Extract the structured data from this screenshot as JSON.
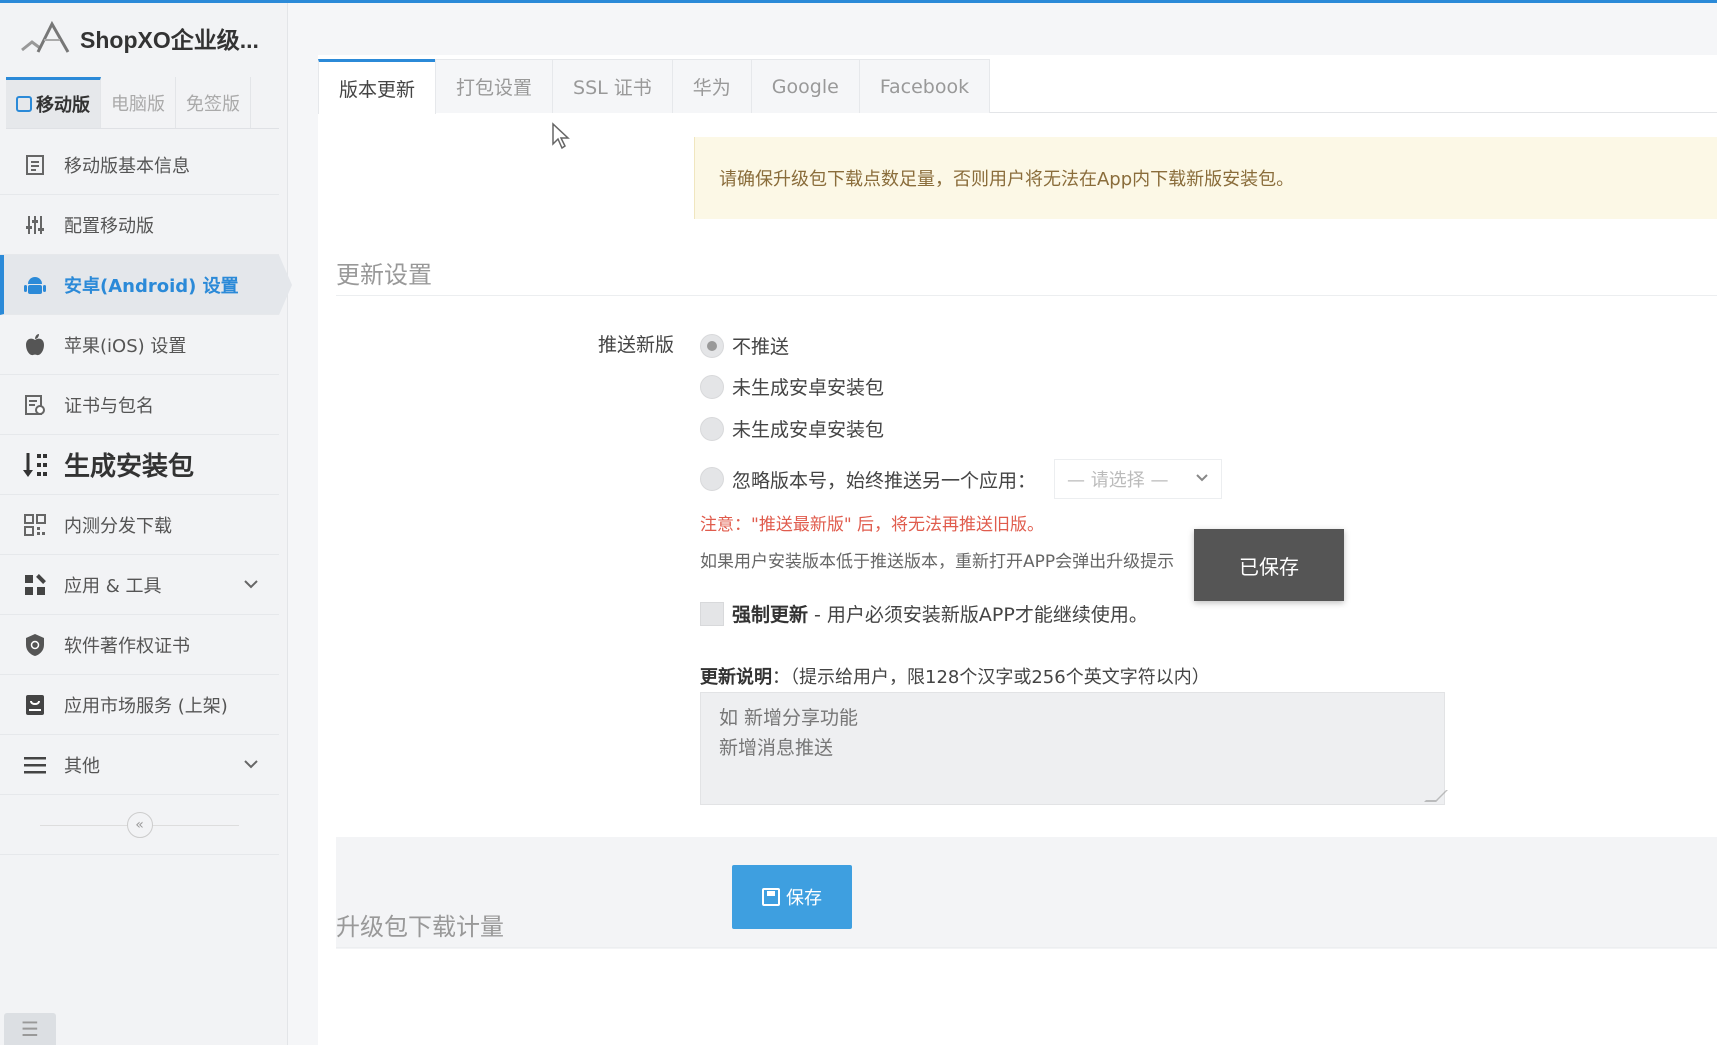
{
  "brand": {
    "title": "ShopXO企业级..."
  },
  "version_tabs": [
    {
      "label": "移动版",
      "active": true
    },
    {
      "label": "电脑版",
      "active": false
    },
    {
      "label": "免签版",
      "active": false
    }
  ],
  "nav": {
    "items": [
      {
        "label": "移动版基本信息",
        "icon": "document-icon"
      },
      {
        "label": "配置移动版",
        "icon": "sliders-icon"
      },
      {
        "label": "安卓(Android) 设置",
        "icon": "android-icon",
        "active": true
      },
      {
        "label": "苹果(iOS) 设置",
        "icon": "apple-icon"
      },
      {
        "label": "证书与包名",
        "icon": "certificate-icon"
      },
      {
        "label": "生成安装包",
        "icon": "sort-download-icon",
        "big": true
      },
      {
        "label": "内测分发下载",
        "icon": "qrcode-icon"
      },
      {
        "label": "应用 & 工具",
        "icon": "apps-icon",
        "expandable": true
      },
      {
        "label": "软件著作权证书",
        "icon": "shield-icon"
      },
      {
        "label": "应用市场服务 (上架)",
        "icon": "store-icon"
      },
      {
        "label": "其他",
        "icon": "menu-icon",
        "expandable": true
      }
    ],
    "collapse_glyph": "«",
    "toggle_glyph": "☰"
  },
  "tabs": [
    {
      "label": "版本更新",
      "active": true
    },
    {
      "label": "打包设置"
    },
    {
      "label": "SSL 证书"
    },
    {
      "label": "华为"
    },
    {
      "label": "Google"
    },
    {
      "label": "Facebook"
    }
  ],
  "notice": "请确保升级包下载点数足量，否则用户将无法在App内下载新版安装包。",
  "update_settings": {
    "title": "更新设置",
    "push_label": "推送新版",
    "options": [
      {
        "label": "不推送",
        "checked": true
      },
      {
        "label": "未生成安卓安装包",
        "checked": false
      },
      {
        "label": "未生成安卓安装包",
        "checked": false
      },
      {
        "label": "忽略版本号，始终推送另一个应用：",
        "checked": false
      }
    ],
    "select_placeholder": "— 请选择 —",
    "warning": "注意：\"推送最新版\" 后，将无法再推送旧版。",
    "hint": "如果用户安装版本低于推送版本，重新打开APP会弹出升级提示",
    "force_update_bold": "强制更新",
    "force_update_text": "- 用户必须安装新版APP才能继续使用。",
    "desc_label_bold": "更新说明",
    "desc_label_text": "：（提示给用户，限128个汉字或256个英文字符以内）",
    "desc_value": "如 新增分享功能\n新增消息推送",
    "save_label": "保存",
    "toast": "已保存"
  },
  "download_section": {
    "title": "升级包下载计量"
  },
  "colors": {
    "accent": "#2b8ad8",
    "button": "#3e9fe0",
    "warning": "#e05c4d",
    "notice_bg": "#fcf8e6"
  }
}
